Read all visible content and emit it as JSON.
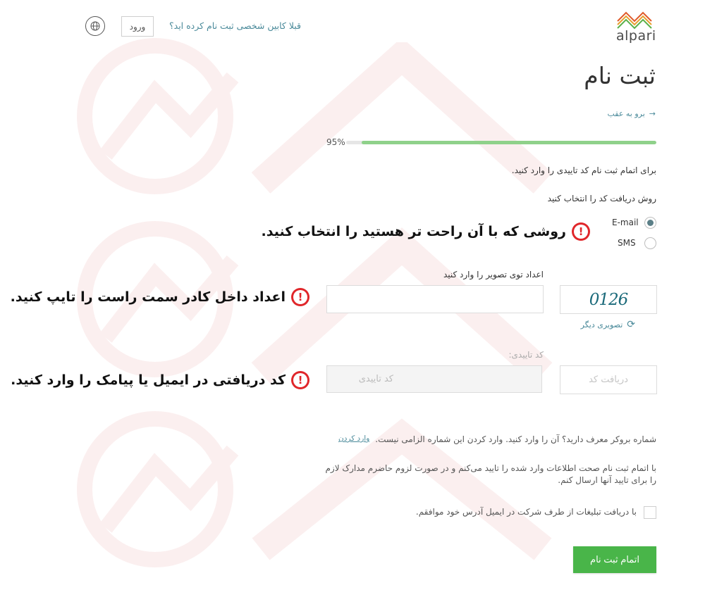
{
  "header": {
    "logo_text": "alpari",
    "already_registered": "قبلا کابین شخصی ثبت نام کرده اید؟",
    "login_label": "ورود",
    "globe_icon": "globe-icon"
  },
  "page": {
    "title": "ثبت نام",
    "back_link": "برو به عقب",
    "progress_percent_label": "95%",
    "progress_value": 0.95,
    "instruction": "برای اتمام ثبت نام کد تاییدی را وارد کنید.",
    "method_label": "روش دریافت کد را انتخاب کنید"
  },
  "methods": {
    "email": "E-mail",
    "sms": "SMS",
    "selected": "email"
  },
  "annotations": {
    "method_hint": "روشی که با آن راحت تر هستید را انتخاب کنید.",
    "captcha_hint": "اعداد داخل کادر سمت راست را تایپ کنید.",
    "code_hint": "کد دریافتی در ایمیل یا پیامک را وارد کنید."
  },
  "captcha": {
    "label": "اعداد توی تصویر را وارد کنید",
    "image_text": "0126",
    "refresh_label": "تصویری دیگر"
  },
  "code": {
    "label": "کد تاییدی:",
    "placeholder": "کد تاییدی",
    "get_code_label": "دریافت کد"
  },
  "referral": {
    "text": "شماره بروکر معرف دارید؟ آن را وارد کنید. وارد کردن این شماره الزامی نیست.",
    "link": "وارد کردن"
  },
  "terms_text": "با اتمام ثبت نام صحت اطلاعات وارد شده را تایید می‌کنم و در صورت لزوم حاضرم مدارک لازم را برای تایید آنها ارسال کنم.",
  "promo_checkbox_label": "با دریافت تبلیغات از طرف شرکت در ایمیل آدرس خود موافقم.",
  "submit_label": "اتمام ثبت نام",
  "colors": {
    "accent": "#49b549",
    "progress": "#8fd18a",
    "link": "#4a8a9a",
    "warning": "#e0262a"
  }
}
